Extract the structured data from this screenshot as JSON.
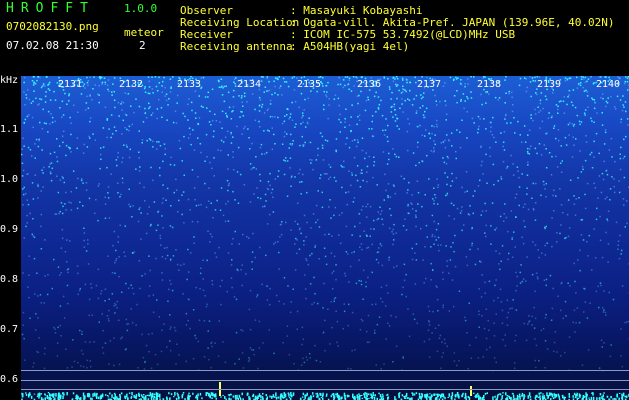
{
  "header": {
    "logo": "HROFFT",
    "version": "1.0.0",
    "filename": "0702082130.png",
    "datetime": "07.02.08 21:30",
    "meteor_label": "meteor",
    "meteor_count": "2",
    "fields": [
      {
        "label": "Observer",
        "value": ": Masayuki Kobayashi"
      },
      {
        "label": "Receiving Location",
        "value": ": Ogata-vill. Akita-Pref. JAPAN (139.96E, 40.02N)"
      },
      {
        "label": "Receiver",
        "value": ": ICOM IC-575 53.7492(@LCD)MHz USB"
      },
      {
        "label": "Receiving antenna",
        "value": ": A504HB(yagi 4el)"
      }
    ]
  },
  "chart_data": {
    "type": "heatmap",
    "ylabel": "kHz",
    "yticks": [
      "1.1",
      "1.0",
      "0.9",
      "0.8",
      "0.7",
      "0.6"
    ],
    "ylim": [
      0.58,
      1.17
    ],
    "time_labels": [
      "2131",
      "2132",
      "2133",
      "2134",
      "2135",
      "2136",
      "2137",
      "2138",
      "2139",
      "2140"
    ],
    "colors": {
      "low": "#050f3c",
      "mid": "#1848c4",
      "high": "#33ffff",
      "spot": "#ffff66"
    }
  }
}
